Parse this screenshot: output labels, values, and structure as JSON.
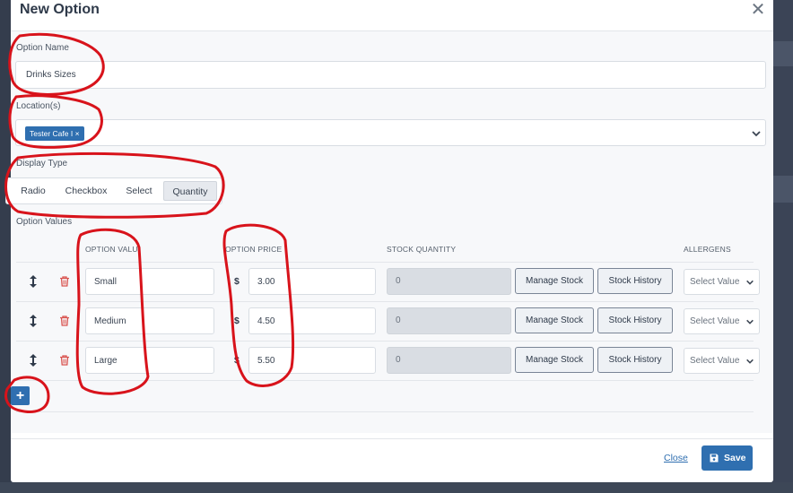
{
  "modal": {
    "title": "New Option"
  },
  "fields": {
    "option_name_label": "Option Name",
    "option_name_value": "Drinks Sizes",
    "locations_label": "Location(s)",
    "location_tag": "Tester Cafe I",
    "display_type_label": "Display Type",
    "display_types": [
      "Radio",
      "Checkbox",
      "Select",
      "Quantity"
    ],
    "display_type_selected": "Quantity",
    "option_values_label": "Option Values"
  },
  "table": {
    "columns": [
      "OPTION VALU",
      "OPTION PRICE",
      "STOCK QUANTITY",
      "ALLERGENS"
    ],
    "rows": [
      {
        "value": "Small",
        "currency": "$",
        "price": "3.00",
        "stock": "0",
        "manage_stock": "Manage Stock",
        "stock_history": "Stock History",
        "allergens": "Select Value"
      },
      {
        "value": "Medium",
        "currency": "$",
        "price": "4.50",
        "stock": "0",
        "manage_stock": "Manage Stock",
        "stock_history": "Stock History",
        "allergens": "Select Value"
      },
      {
        "value": "Large",
        "currency": "$",
        "price": "5.50",
        "stock": "0",
        "manage_stock": "Manage Stock",
        "stock_history": "Stock History",
        "allergens": "Select Value"
      }
    ],
    "add_label": "+"
  },
  "footer": {
    "close_label": "Close",
    "save_label": "Save"
  },
  "colors": {
    "primary": "#2f6fb0",
    "annotation": "#d8131b",
    "delete": "#d9534f"
  },
  "icons": [
    "close-icon",
    "chevron-down-icon",
    "move-icon",
    "trash-icon",
    "plus-icon",
    "save-icon"
  ]
}
